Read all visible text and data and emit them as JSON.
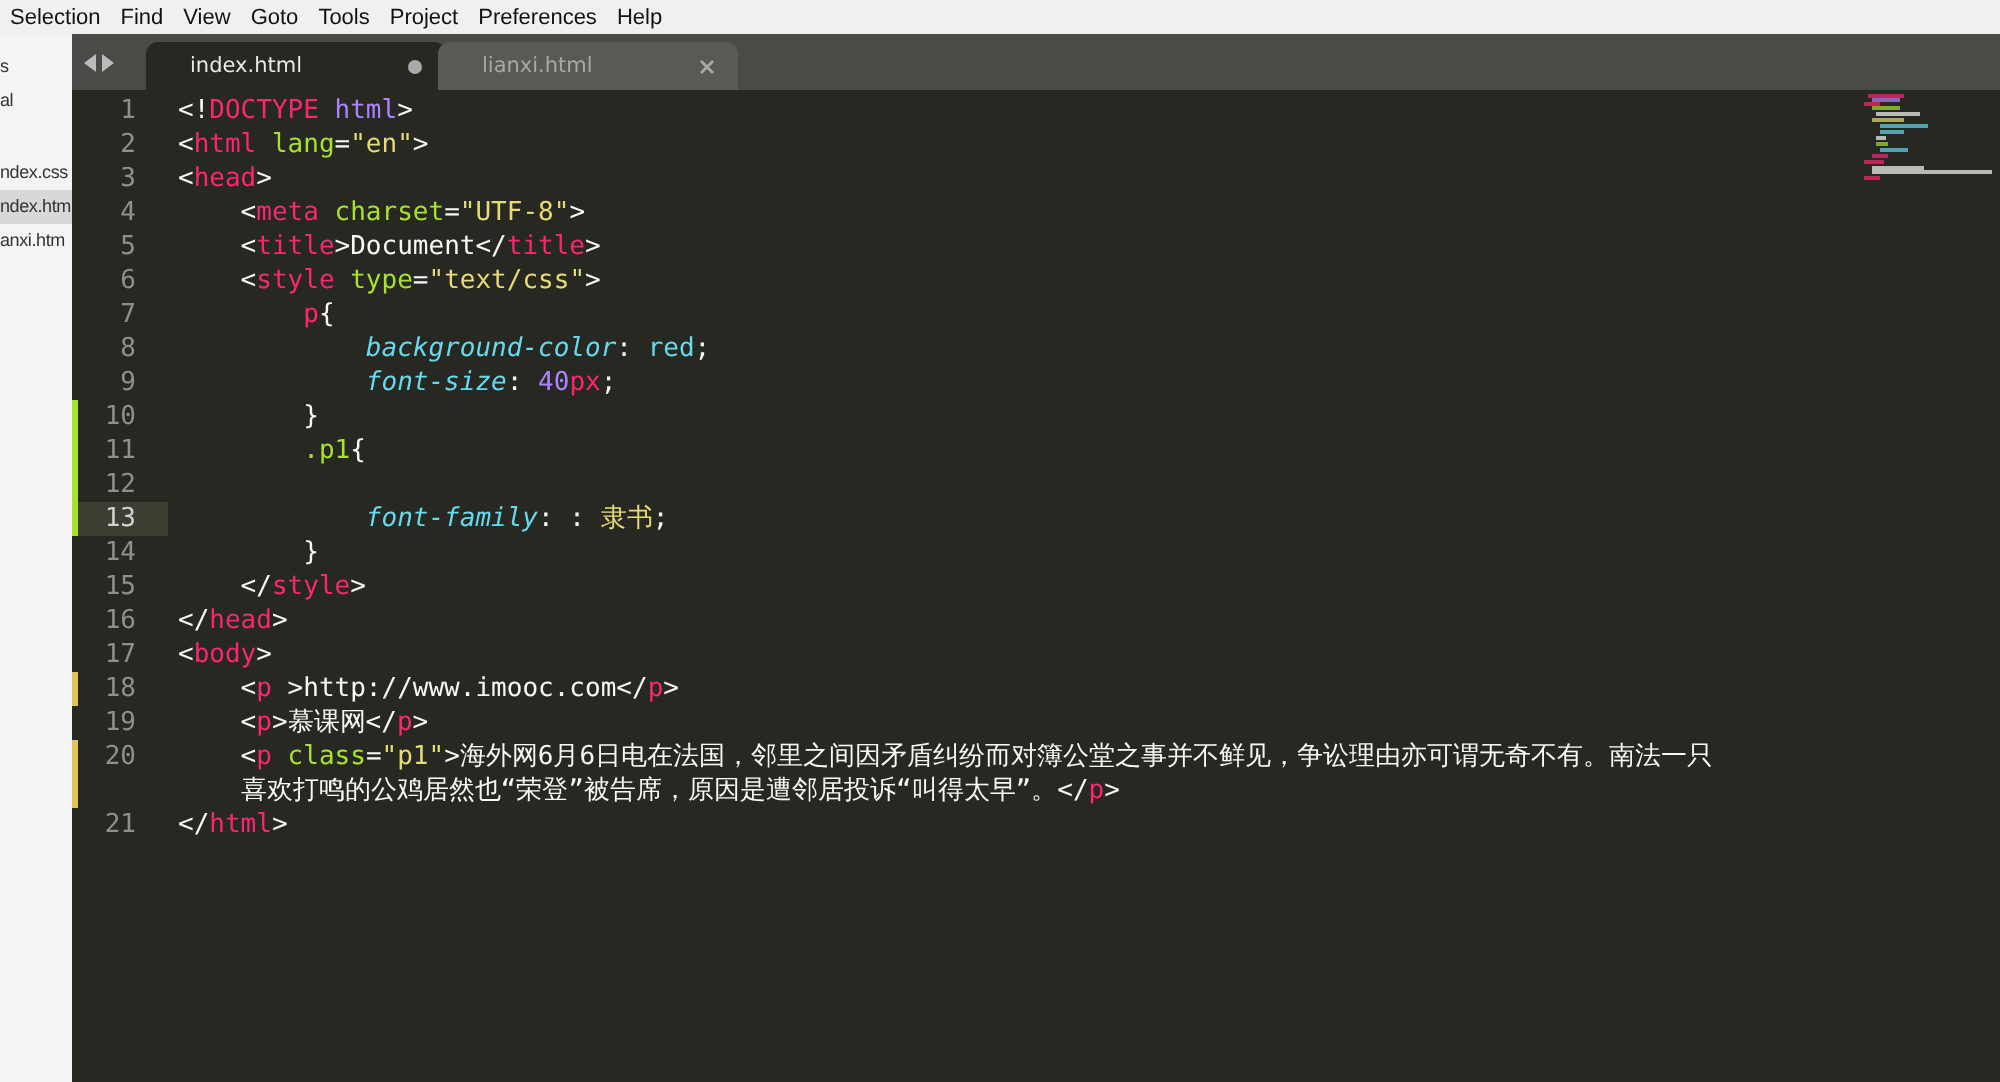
{
  "menu": [
    {
      "label": "Selection"
    },
    {
      "label": "Find"
    },
    {
      "label": "View"
    },
    {
      "label": "Goto"
    },
    {
      "label": "Tools"
    },
    {
      "label": "Project"
    },
    {
      "label": "Preferences"
    },
    {
      "label": "Help"
    }
  ],
  "sidebar": {
    "items": [
      {
        "label": "s",
        "selected": false
      },
      {
        "label": "al",
        "selected": false
      },
      {
        "label": "ndex.css",
        "selected": false
      },
      {
        "label": "ndex.htm",
        "selected": true
      },
      {
        "label": "anxi.htm",
        "selected": false
      }
    ]
  },
  "tabs": [
    {
      "label": "index.html",
      "selected": true,
      "dirty": true
    },
    {
      "label": "lianxi.html",
      "selected": false,
      "dirty": false
    }
  ],
  "lines": [
    {
      "number": "1",
      "current": false,
      "added": false,
      "modified": false,
      "tokens": [
        {
          "kind": "plain",
          "text": "<!"
        },
        {
          "kind": "tag",
          "text": "DOCTYPE"
        },
        {
          "kind": "const",
          "text": " html"
        },
        {
          "kind": "plain",
          "text": ">"
        }
      ]
    },
    {
      "number": "2",
      "current": false,
      "added": false,
      "modified": false,
      "tokens": [
        {
          "kind": "plain",
          "text": "<"
        },
        {
          "kind": "tag",
          "text": "html"
        },
        {
          "kind": "attr",
          "text": " lang"
        },
        {
          "kind": "plain",
          "text": "="
        },
        {
          "kind": "string",
          "text": "\"en\""
        },
        {
          "kind": "plain",
          "text": ">"
        }
      ]
    },
    {
      "number": "3",
      "current": false,
      "added": false,
      "modified": false,
      "tokens": [
        {
          "kind": "plain",
          "text": "<"
        },
        {
          "kind": "tag",
          "text": "head"
        },
        {
          "kind": "plain",
          "text": ">"
        }
      ]
    },
    {
      "number": "4",
      "current": false,
      "added": false,
      "modified": false,
      "tokens": [
        {
          "kind": "plain",
          "text": "    <"
        },
        {
          "kind": "tag",
          "text": "meta"
        },
        {
          "kind": "attr",
          "text": " charset"
        },
        {
          "kind": "plain",
          "text": "="
        },
        {
          "kind": "string",
          "text": "\"UTF-8\""
        },
        {
          "kind": "plain",
          "text": ">"
        }
      ]
    },
    {
      "number": "5",
      "current": false,
      "added": false,
      "modified": false,
      "tokens": [
        {
          "kind": "plain",
          "text": "    <"
        },
        {
          "kind": "tag",
          "text": "title"
        },
        {
          "kind": "plain",
          "text": ">Document</"
        },
        {
          "kind": "tag",
          "text": "title"
        },
        {
          "kind": "plain",
          "text": ">"
        }
      ]
    },
    {
      "number": "6",
      "current": false,
      "added": false,
      "modified": false,
      "tokens": [
        {
          "kind": "plain",
          "text": "    <"
        },
        {
          "kind": "tag",
          "text": "style"
        },
        {
          "kind": "attr",
          "text": " type"
        },
        {
          "kind": "plain",
          "text": "="
        },
        {
          "kind": "string",
          "text": "\"text/css\""
        },
        {
          "kind": "plain",
          "text": ">"
        }
      ]
    },
    {
      "number": "7",
      "current": false,
      "added": false,
      "modified": false,
      "tokens": [
        {
          "kind": "tag",
          "text": "        p"
        },
        {
          "kind": "plain",
          "text": "{"
        }
      ]
    },
    {
      "number": "8",
      "current": false,
      "added": false,
      "modified": false,
      "tokens": [
        {
          "kind": "prop",
          "text": "            background-color"
        },
        {
          "kind": "plain",
          "text": ": "
        },
        {
          "kind": "value",
          "text": "red"
        },
        {
          "kind": "plain",
          "text": ";"
        }
      ]
    },
    {
      "number": "9",
      "current": false,
      "added": false,
      "modified": false,
      "tokens": [
        {
          "kind": "prop",
          "text": "            font-size"
        },
        {
          "kind": "plain",
          "text": ": "
        },
        {
          "kind": "const",
          "text": "40"
        },
        {
          "kind": "tag",
          "text": "px"
        },
        {
          "kind": "plain",
          "text": ";"
        }
      ]
    },
    {
      "number": "10",
      "current": false,
      "added": true,
      "modified": false,
      "tokens": [
        {
          "kind": "plain",
          "text": "        }"
        }
      ]
    },
    {
      "number": "11",
      "current": false,
      "added": true,
      "modified": false,
      "tokens": [
        {
          "kind": "attr",
          "text": "        .p1"
        },
        {
          "kind": "plain",
          "text": "{"
        }
      ]
    },
    {
      "number": "12",
      "current": false,
      "added": true,
      "modified": false
    },
    {
      "number": "13",
      "current": true,
      "added": true,
      "modified": false,
      "tokens": [
        {
          "kind": "prop",
          "text": "            font-family"
        },
        {
          "kind": "plain",
          "text": ": : "
        },
        {
          "kind": "string",
          "text": "隶书"
        },
        {
          "kind": "plain",
          "text": ";"
        }
      ]
    },
    {
      "number": "14",
      "current": false,
      "added": false,
      "modified": false,
      "tokens": [
        {
          "kind": "plain",
          "text": "        }"
        }
      ]
    },
    {
      "number": "15",
      "current": false,
      "added": false,
      "modified": false,
      "tokens": [
        {
          "kind": "plain",
          "text": "    </"
        },
        {
          "kind": "tag",
          "text": "style"
        },
        {
          "kind": "plain",
          "text": ">"
        }
      ]
    },
    {
      "number": "16",
      "current": false,
      "added": false,
      "modified": false,
      "tokens": [
        {
          "kind": "plain",
          "text": "</"
        },
        {
          "kind": "tag",
          "text": "head"
        },
        {
          "kind": "plain",
          "text": ">"
        }
      ]
    },
    {
      "number": "17",
      "current": false,
      "added": false,
      "modified": false,
      "tokens": [
        {
          "kind": "plain",
          "text": "<"
        },
        {
          "kind": "tag",
          "text": "body"
        },
        {
          "kind": "plain",
          "text": ">"
        }
      ]
    },
    {
      "number": "18",
      "current": false,
      "added": false,
      "modified": true,
      "tokens": [
        {
          "kind": "plain",
          "text": "    <"
        },
        {
          "kind": "tag",
          "text": "p"
        },
        {
          "kind": "plain",
          "text": " >http://www.imooc.com</"
        },
        {
          "kind": "tag",
          "text": "p"
        },
        {
          "kind": "plain",
          "text": ">"
        }
      ]
    },
    {
      "number": "19",
      "current": false,
      "added": false,
      "modified": false,
      "tokens": [
        {
          "kind": "plain",
          "text": "    <"
        },
        {
          "kind": "tag",
          "text": "p"
        },
        {
          "kind": "plain",
          "text": ">慕课网</"
        },
        {
          "kind": "tag",
          "text": "p"
        },
        {
          "kind": "plain",
          "text": ">"
        }
      ]
    },
    {
      "number": "20",
      "current": false,
      "added": false,
      "modified": true,
      "tokens": [
        {
          "kind": "plain",
          "text": "    <"
        },
        {
          "kind": "tag",
          "text": "p"
        },
        {
          "kind": "attr",
          "text": " class"
        },
        {
          "kind": "plain",
          "text": "="
        },
        {
          "kind": "string",
          "text": "\"p1\""
        },
        {
          "kind": "plain",
          "text": ">海外网6月6日电在法国，邻里之间因矛盾纠纷而对簿公堂之事并不鲜见，争讼理由亦可谓无奇不有。南法一只"
        }
      ],
      "wrap_tokens": [
        {
          "kind": "plain",
          "text": "    喜欢打鸣的公鸡居然也“荣登”被告席，原因是遭邻居投诉“叫得太早”。</"
        },
        {
          "kind": "tag",
          "text": "p"
        },
        {
          "kind": "plain",
          "text": ">"
        }
      ]
    },
    {
      "number": "21",
      "current": false,
      "added": false,
      "modified": false,
      "tokens": [
        {
          "kind": "plain",
          "text": "</"
        },
        {
          "kind": "tag",
          "text": "html"
        },
        {
          "kind": "plain",
          "text": ">"
        }
      ]
    }
  ]
}
